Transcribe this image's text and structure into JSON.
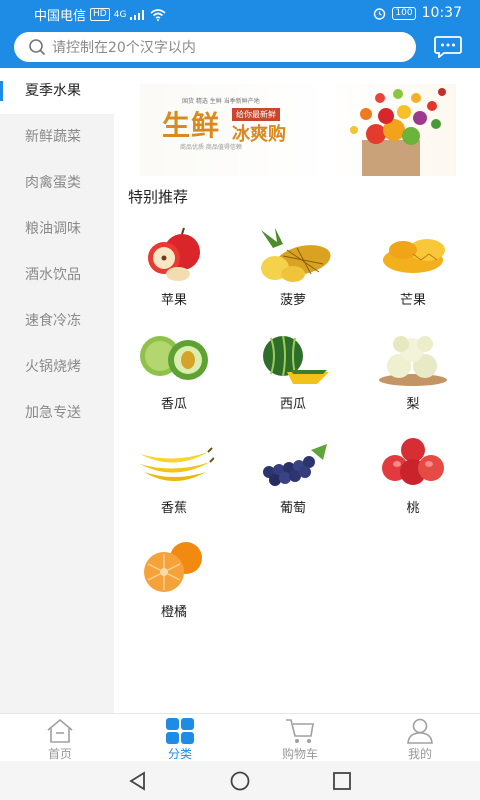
{
  "status": {
    "carrier": "中国电信",
    "hd": "HD",
    "net": "4G",
    "battery": "100",
    "time": "10:37"
  },
  "search": {
    "placeholder": "请控制在20个汉字以内"
  },
  "sidebar": {
    "items": [
      {
        "label": "夏季水果",
        "active": true
      },
      {
        "label": "新鲜蔬菜"
      },
      {
        "label": "肉禽蛋类"
      },
      {
        "label": "粮油调味"
      },
      {
        "label": "酒水饮品"
      },
      {
        "label": "速食冷冻"
      },
      {
        "label": "火锅烧烤"
      },
      {
        "label": "加急专送"
      }
    ]
  },
  "banner": {
    "line1": "国货 精选 生鲜   当季新鲜产地",
    "title1": "生鲜",
    "tag": "给你最新鲜",
    "title2": "冰爽购",
    "line2": "商品优质   商品值得信赖"
  },
  "section_title": "特别推荐",
  "products": [
    {
      "name": "苹果",
      "icon": "apple-image"
    },
    {
      "name": "菠萝",
      "icon": "pineapple-image"
    },
    {
      "name": "芒果",
      "icon": "mango-image"
    },
    {
      "name": "香瓜",
      "icon": "melon-image"
    },
    {
      "name": "西瓜",
      "icon": "watermelon-image"
    },
    {
      "name": "梨",
      "icon": "pear-image"
    },
    {
      "name": "香蕉",
      "icon": "banana-image"
    },
    {
      "name": "葡萄",
      "icon": "grape-image"
    },
    {
      "name": "桃",
      "icon": "peach-image"
    },
    {
      "name": "橙橘",
      "icon": "orange-image"
    }
  ],
  "bottom_nav": [
    {
      "label": "首页",
      "icon": "home-icon"
    },
    {
      "label": "分类",
      "icon": "category-icon",
      "active": true
    },
    {
      "label": "购物车",
      "icon": "cart-icon"
    },
    {
      "label": "我的",
      "icon": "user-icon"
    }
  ],
  "colors": {
    "accent": "#1e8be5",
    "sidebar_bg": "#f3f3f3"
  }
}
